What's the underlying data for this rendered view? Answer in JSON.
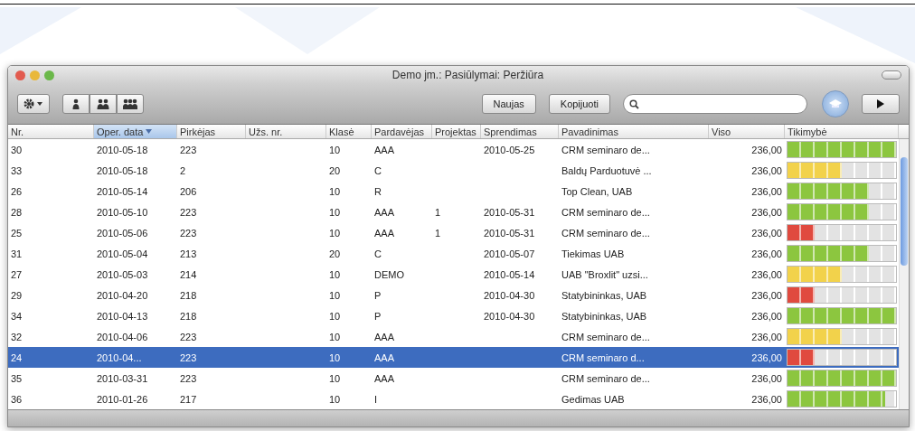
{
  "window": {
    "title": "Demo jm.: Pasiūlymai: Peržiūra"
  },
  "toolbar": {
    "buttons": [
      "Naujas",
      "Kopijuoti"
    ]
  },
  "table": {
    "columns": [
      {
        "label": "Nr.",
        "selected": false
      },
      {
        "label": "Oper. data",
        "selected": true
      },
      {
        "label": "Pirkėjas",
        "selected": false
      },
      {
        "label": "Užs. nr.",
        "selected": false
      },
      {
        "label": "Klasė",
        "selected": false
      },
      {
        "label": "Pardavėjas",
        "selected": false
      },
      {
        "label": "Projektas",
        "selected": false
      },
      {
        "label": "Sprendimas",
        "selected": false
      },
      {
        "label": "Pavadinimas",
        "selected": false
      },
      {
        "label": "Viso",
        "selected": false
      },
      {
        "label": "Tikimybė",
        "selected": false
      }
    ],
    "rows": [
      {
        "nr": "30",
        "date": "2010-05-18",
        "buyer": "223",
        "klase": "10",
        "seller": "AAA",
        "decision": "2010-05-25",
        "name": "CRM seminaro de...",
        "total": "236,00",
        "level": 1,
        "color": "#8cc63f",
        "selected": false
      },
      {
        "nr": "33",
        "date": "2010-05-18",
        "buyer": "2",
        "klase": "20",
        "seller": "C",
        "name": "Baldų Parduotuvė ...",
        "total": "236,00",
        "level": 0.5,
        "color": "#f2d24b",
        "selected": false
      },
      {
        "nr": "26",
        "date": "2010-05-14",
        "buyer": "206",
        "klase": "10",
        "seller": "R",
        "name": "Top Clean, UAB",
        "total": "236,00",
        "level": 0.75,
        "color": "#8cc63f",
        "selected": false
      },
      {
        "nr": "28",
        "date": "2010-05-10",
        "buyer": "223",
        "klase": "10",
        "seller": "AAA",
        "project": "1",
        "decision": "2010-05-31",
        "name": "CRM seminaro de...",
        "total": "236,00",
        "level": 0.75,
        "color": "#8cc63f",
        "selected": false
      },
      {
        "nr": "25",
        "date": "2010-05-06",
        "buyer": "223",
        "klase": "10",
        "seller": "AAA",
        "project": "1",
        "decision": "2010-05-31",
        "name": "CRM seminaro de...",
        "total": "236,00",
        "level": 0.25,
        "color": "#e04a3f",
        "selected": false
      },
      {
        "nr": "31",
        "date": "2010-05-04",
        "buyer": "213",
        "klase": "20",
        "seller": "C",
        "decision": "2010-05-07",
        "name": "Tiekimas UAB",
        "total": "236,00",
        "level": 0.75,
        "color": "#8cc63f",
        "selected": false
      },
      {
        "nr": "27",
        "date": "2010-05-03",
        "buyer": "214",
        "klase": "10",
        "seller": "DEMO",
        "decision": "2010-05-14",
        "name": "UAB \"Broxlit\" uzsi...",
        "total": "236,00",
        "level": 0.5,
        "color": "#f2d24b",
        "selected": false
      },
      {
        "nr": "29",
        "date": "2010-04-20",
        "buyer": "218",
        "klase": "10",
        "seller": "P",
        "decision": "2010-04-30",
        "name": "Statybininkas, UAB",
        "total": "236,00",
        "level": 0.25,
        "color": "#e04a3f",
        "selected": false
      },
      {
        "nr": "34",
        "date": "2010-04-13",
        "buyer": "218",
        "klase": "10",
        "seller": "P",
        "decision": "2010-04-30",
        "name": "Statybininkas, UAB",
        "total": "236,00",
        "level": 1,
        "color": "#8cc63f",
        "selected": false
      },
      {
        "nr": "32",
        "date": "2010-04-06",
        "buyer": "223",
        "klase": "10",
        "seller": "AAA",
        "name": "CRM seminaro de...",
        "total": "236,00",
        "level": 0.5,
        "color": "#f2d24b",
        "selected": false
      },
      {
        "nr": "24",
        "date": "2010-04...",
        "buyer": "223",
        "klase": "10",
        "seller": "AAA",
        "name": "CRM seminaro d...",
        "total": "236,00",
        "level": 0.25,
        "color": "#e04a3f",
        "selected": true
      },
      {
        "nr": "35",
        "date": "2010-03-31",
        "buyer": "223",
        "klase": "10",
        "seller": "AAA",
        "name": "CRM seminaro de...",
        "total": "236,00",
        "level": 1,
        "color": "#8cc63f",
        "selected": false
      },
      {
        "nr": "36",
        "date": "2010-01-26",
        "buyer": "217",
        "klase": "10",
        "seller": "I",
        "name": "Gedimas UAB",
        "total": "236,00",
        "level": 0.9,
        "color": "#8cc63f",
        "selected": false
      }
    ]
  }
}
